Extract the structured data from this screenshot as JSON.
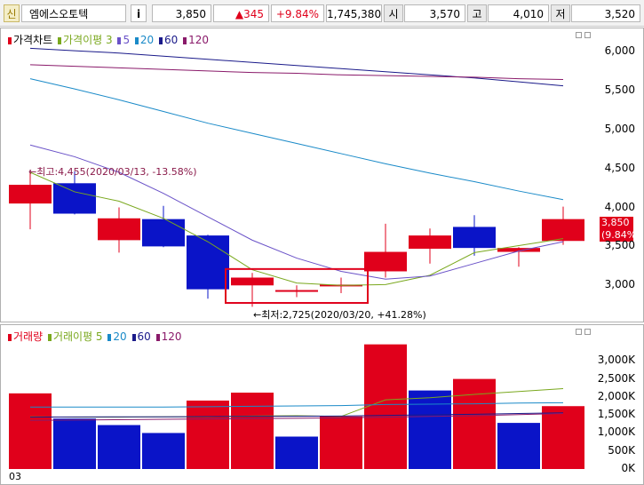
{
  "toolbar": {
    "badge": "신",
    "name": "엠에스오토텍",
    "info_button": "i",
    "price": "3,850",
    "change": "▲345",
    "change_pct": "+9.84%",
    "volume": "1,745,380",
    "open_label": "시",
    "open": "3,570",
    "high_label": "고",
    "high": "4,010",
    "low_label": "저",
    "low": "3,520"
  },
  "price_legend": {
    "title": "가격차트",
    "ma_label": "가격이평 3",
    "ma5": "5",
    "ma20": "20",
    "ma60": "60",
    "ma120": "120"
  },
  "volume_legend": {
    "title": "거래량",
    "ma_label": "거래이평 5",
    "ma20": "20",
    "ma60": "60",
    "ma120": "120"
  },
  "annotations": {
    "high_note": "←최고:4,455(2020/03/13, -13.58%)",
    "low_note": "←최저:2,725(2020/03/20, +41.28%)",
    "last_price": "3,850",
    "last_pct": "(9.84%)"
  },
  "x_axis_label": "03",
  "colors": {
    "up": "#e0001b",
    "down": "#0a14c8",
    "ma3": "#7aa81e",
    "ma5": "#6a52c8",
    "ma20": "#1a8ac8",
    "ma60": "#1a1a8a",
    "ma120": "#8a1a6a",
    "highlight_box": "#e0001b"
  },
  "chart_data": [
    {
      "type": "candlestick",
      "title": "가격차트",
      "ylim": [
        2650,
        6250
      ],
      "yticks": [
        {
          "v": 3000,
          "label": "3,000"
        },
        {
          "v": 3500,
          "label": "3,500"
        },
        {
          "v": 4000,
          "label": "4,000"
        },
        {
          "v": 4500,
          "label": "4,500"
        },
        {
          "v": 5000,
          "label": "5,000"
        },
        {
          "v": 5500,
          "label": "5,500"
        },
        {
          "v": 6000,
          "label": "6,000"
        }
      ],
      "candles": [
        {
          "o": 4050,
          "h": 4455,
          "l": 3720,
          "c": 4290
        },
        {
          "o": 4310,
          "h": 4460,
          "l": 3910,
          "c": 3920
        },
        {
          "o": 3580,
          "h": 4000,
          "l": 3420,
          "c": 3860
        },
        {
          "o": 3850,
          "h": 4020,
          "l": 3490,
          "c": 3500
        },
        {
          "o": 3640,
          "h": 3650,
          "l": 2830,
          "c": 2950
        },
        {
          "o": 3000,
          "h": 3160,
          "l": 2725,
          "c": 3100
        },
        {
          "o": 2920,
          "h": 3000,
          "l": 2850,
          "c": 2940
        },
        {
          "o": 3000,
          "h": 3100,
          "l": 2900,
          "c": 3010
        },
        {
          "o": 3180,
          "h": 3790,
          "l": 3100,
          "c": 3430
        },
        {
          "o": 3470,
          "h": 3730,
          "l": 3280,
          "c": 3640
        },
        {
          "o": 3750,
          "h": 3900,
          "l": 3380,
          "c": 3480
        },
        {
          "o": 3430,
          "h": 3490,
          "l": 3240,
          "c": 3480
        },
        {
          "o": 3570,
          "h": 4010,
          "l": 3520,
          "c": 3850
        }
      ],
      "series": [
        {
          "name": "3",
          "values": [
            4450,
            4200,
            4080,
            3860,
            3560,
            3200,
            3030,
            3000,
            3010,
            3130,
            3420,
            3510,
            3600
          ]
        },
        {
          "name": "5",
          "values": [
            4800,
            4650,
            4450,
            4180,
            3880,
            3580,
            3350,
            3180,
            3080,
            3120,
            3280,
            3440,
            3560
          ]
        },
        {
          "name": "20",
          "values": [
            5650,
            5520,
            5380,
            5230,
            5080,
            4950,
            4820,
            4690,
            4560,
            4440,
            4330,
            4210,
            4100
          ]
        },
        {
          "name": "60",
          "values": [
            6040,
            6010,
            5980,
            5940,
            5900,
            5860,
            5820,
            5780,
            5740,
            5700,
            5660,
            5610,
            5560
          ]
        },
        {
          "name": "120",
          "values": [
            5830,
            5810,
            5790,
            5770,
            5750,
            5730,
            5720,
            5700,
            5690,
            5680,
            5670,
            5650,
            5640
          ]
        }
      ]
    },
    {
      "type": "bar",
      "title": "거래량",
      "ylim": [
        0,
        3600
      ],
      "yticks": [
        {
          "v": 0,
          "label": "0K"
        },
        {
          "v": 500,
          "label": "500K"
        },
        {
          "v": 1000,
          "label": "1,000K"
        },
        {
          "v": 1500,
          "label": "1,500K"
        },
        {
          "v": 2000,
          "label": "2,000K"
        },
        {
          "v": 2500,
          "label": "2,500K"
        },
        {
          "v": 3000,
          "label": "3,000K"
        }
      ],
      "values": [
        2100,
        1400,
        1220,
        1000,
        1900,
        2120,
        900,
        1460,
        3460,
        2180,
        2500,
        1280,
        1745
      ],
      "directions": [
        "up",
        "down",
        "down",
        "down",
        "up",
        "up",
        "down",
        "up",
        "up",
        "down",
        "up",
        "down",
        "up"
      ],
      "series": [
        {
          "name": "5",
          "values": [
            1450,
            1440,
            1440,
            1450,
            1450,
            1470,
            1480,
            1460,
            1920,
            1980,
            2070,
            2150,
            2230
          ]
        },
        {
          "name": "20",
          "values": [
            1720,
            1720,
            1720,
            1720,
            1730,
            1740,
            1750,
            1760,
            1790,
            1800,
            1810,
            1830,
            1840
          ]
        },
        {
          "name": "60",
          "values": [
            1440,
            1445,
            1450,
            1450,
            1455,
            1460,
            1465,
            1470,
            1490,
            1505,
            1520,
            1540,
            1560
          ]
        },
        {
          "name": "120",
          "values": [
            1350,
            1360,
            1370,
            1380,
            1390,
            1400,
            1410,
            1420,
            1440,
            1460,
            1480,
            1510,
            1540
          ]
        }
      ]
    }
  ]
}
